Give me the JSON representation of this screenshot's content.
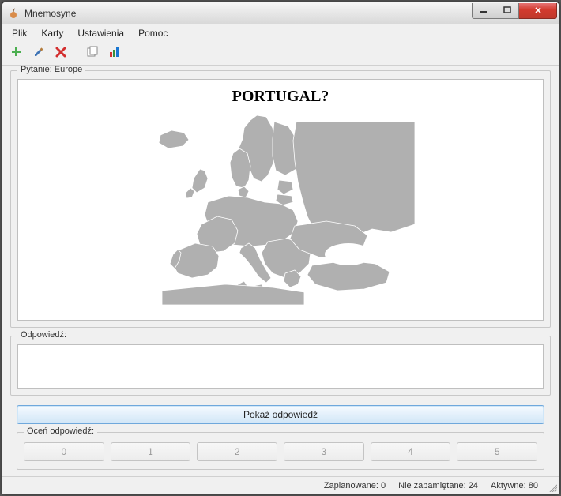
{
  "window": {
    "title": "Mnemosyne"
  },
  "menu": {
    "file": "Plik",
    "cards": "Karty",
    "settings": "Ustawienia",
    "help": "Pomoc"
  },
  "toolbar_icons": {
    "add": "add-card-icon",
    "edit": "edit-card-icon",
    "delete": "delete-card-icon",
    "browse": "browse-cards-icon",
    "stats": "statistics-icon"
  },
  "question": {
    "group_label": "Pytanie: Europe",
    "title": "PORTUGAL?"
  },
  "answer": {
    "group_label": "Odpowiedź:",
    "text": ""
  },
  "show_answer_label": "Pokaż odpowiedź",
  "rate": {
    "group_label": "Oceń odpowiedź:",
    "buttons": [
      "0",
      "1",
      "2",
      "3",
      "4",
      "5"
    ]
  },
  "status": {
    "scheduled_label": "Zaplanowane:",
    "scheduled_value": "0",
    "not_memorised_label": "Nie zapamiętane:",
    "not_memorised_value": "24",
    "active_label": "Aktywne:",
    "active_value": "80"
  }
}
